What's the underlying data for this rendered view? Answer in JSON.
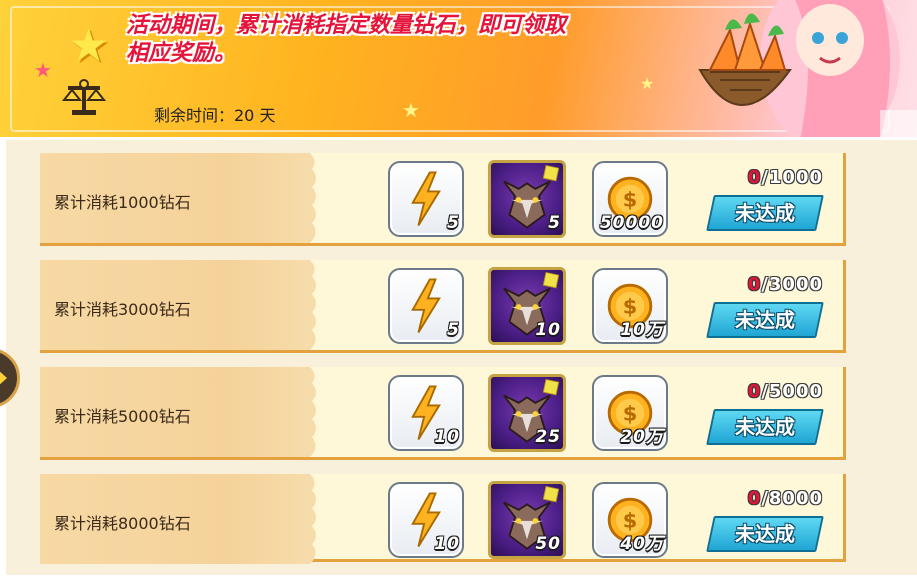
{
  "banner": {
    "description_line1": "活动期间，累计消耗指定数量钻石，即可领取",
    "description_line2": "相应奖励。",
    "time_label": "剩余时间：20 天"
  },
  "rows": [
    {
      "label": "累计消耗1000钻石",
      "energy_qty": "5",
      "wolf_qty": "5",
      "coin_qty": "50000",
      "progress_current": "0",
      "progress_target": "/1000",
      "status": "未达成"
    },
    {
      "label": "累计消耗3000钻石",
      "energy_qty": "5",
      "wolf_qty": "10",
      "coin_qty": "10万",
      "progress_current": "0",
      "progress_target": "/3000",
      "status": "未达成"
    },
    {
      "label": "累计消耗5000钻石",
      "energy_qty": "10",
      "wolf_qty": "25",
      "coin_qty": "20万",
      "progress_current": "0",
      "progress_target": "/5000",
      "status": "未达成"
    },
    {
      "label": "累计消耗8000钻石",
      "energy_qty": "10",
      "wolf_qty": "50",
      "coin_qty": "40万",
      "progress_current": "0",
      "progress_target": "/8000",
      "status": "未达成"
    }
  ],
  "icons": {
    "energy": "lightning-bolt-icon",
    "wolf": "wolf-head-icon",
    "coin": "gold-coin-icon",
    "trophy": "scales-icon",
    "star": "star-icon"
  },
  "colors": {
    "accent_red": "#e4143a",
    "button_blue": "#1fa6d4",
    "row_border": "#e3a23d"
  }
}
